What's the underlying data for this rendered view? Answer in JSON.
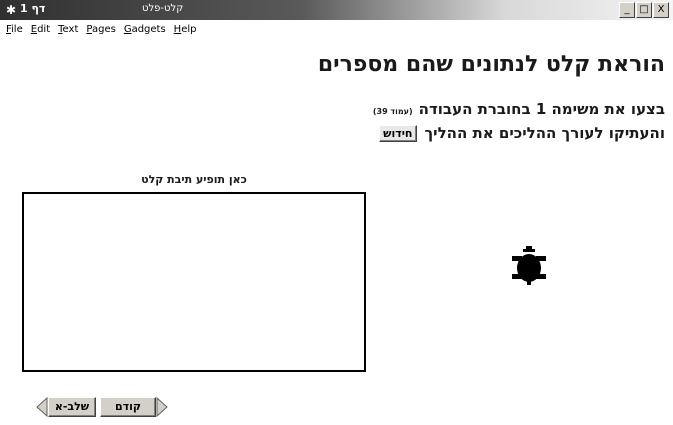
{
  "window": {
    "page_number": "דף 1",
    "title": "קלט-פלט",
    "controls": {
      "minimize": "_",
      "maximize": "□",
      "close": "X"
    }
  },
  "menu": {
    "items": [
      "File",
      "Edit",
      "Text",
      "Pages",
      "Gadgets",
      "Help"
    ]
  },
  "content": {
    "heading": "הוראת קלט לנתונים שהם מספרים",
    "instruction_line1": "בצעו את משימה 1 בחוברת העבודה",
    "page_reference": "(עמוד 39)",
    "instruction_line2": "והעתיקו לעורך ההליכים את ההליך",
    "renew_button": "חידוש",
    "input_box_label": "כאן תופיע תיבת קלט",
    "input_box_value": ""
  },
  "navigation": {
    "previous_button": "קודם",
    "step_button": "שלב-א"
  },
  "icons": {
    "app": "turtle-logo-icon",
    "turtle": "turtle-icon",
    "nav_left": "left-arrow-icon",
    "nav_right": "right-arrow-icon"
  },
  "colors": {
    "titlebar_start": "#303030",
    "titlebar_end": "#f4f4f4",
    "text": "#1a1a1a",
    "button_face": "#d4d0c8"
  }
}
